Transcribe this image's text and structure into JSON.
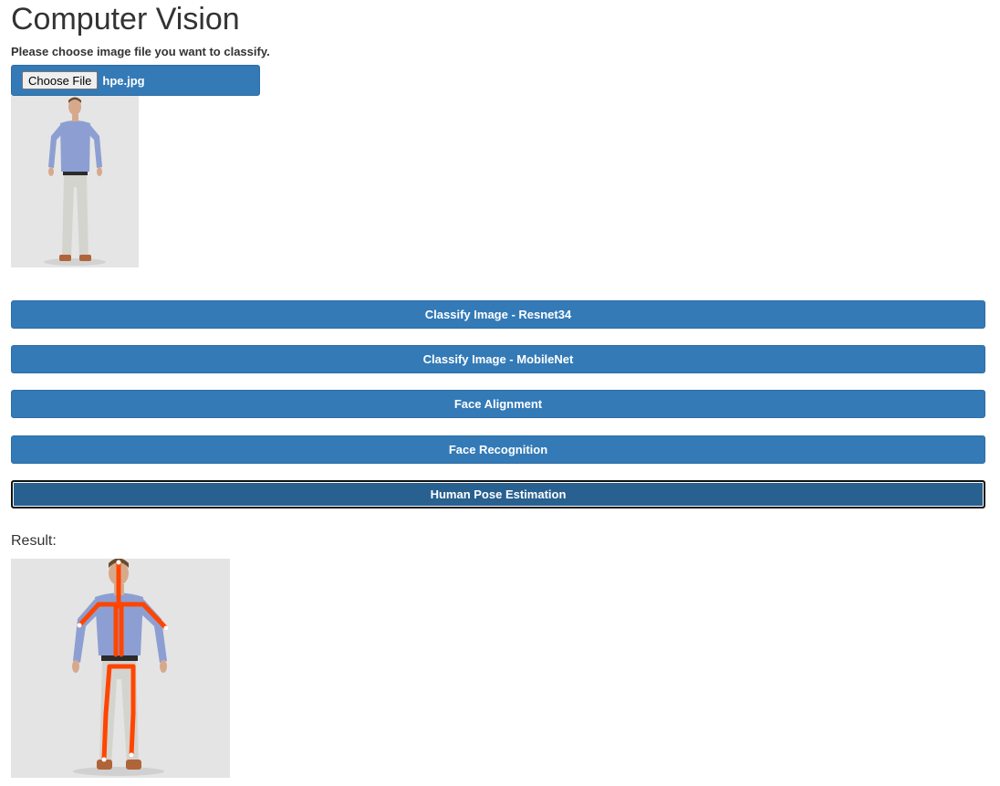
{
  "page": {
    "title": "Computer Vision",
    "instruction": "Please choose image file you want to classify."
  },
  "file_input": {
    "button_label": "Choose File",
    "file_name": "hpe.jpg"
  },
  "actions": [
    {
      "label": "Classify Image - Resnet34"
    },
    {
      "label": "Classify Image - MobileNet"
    },
    {
      "label": "Face Alignment"
    },
    {
      "label": "Face Recognition"
    },
    {
      "label": "Human Pose Estimation",
      "state": "focused"
    }
  ],
  "result": {
    "label": "Result:"
  },
  "colors": {
    "primary": "#337ab7",
    "primary_active": "#286090",
    "pose_line": "#ff4500"
  }
}
